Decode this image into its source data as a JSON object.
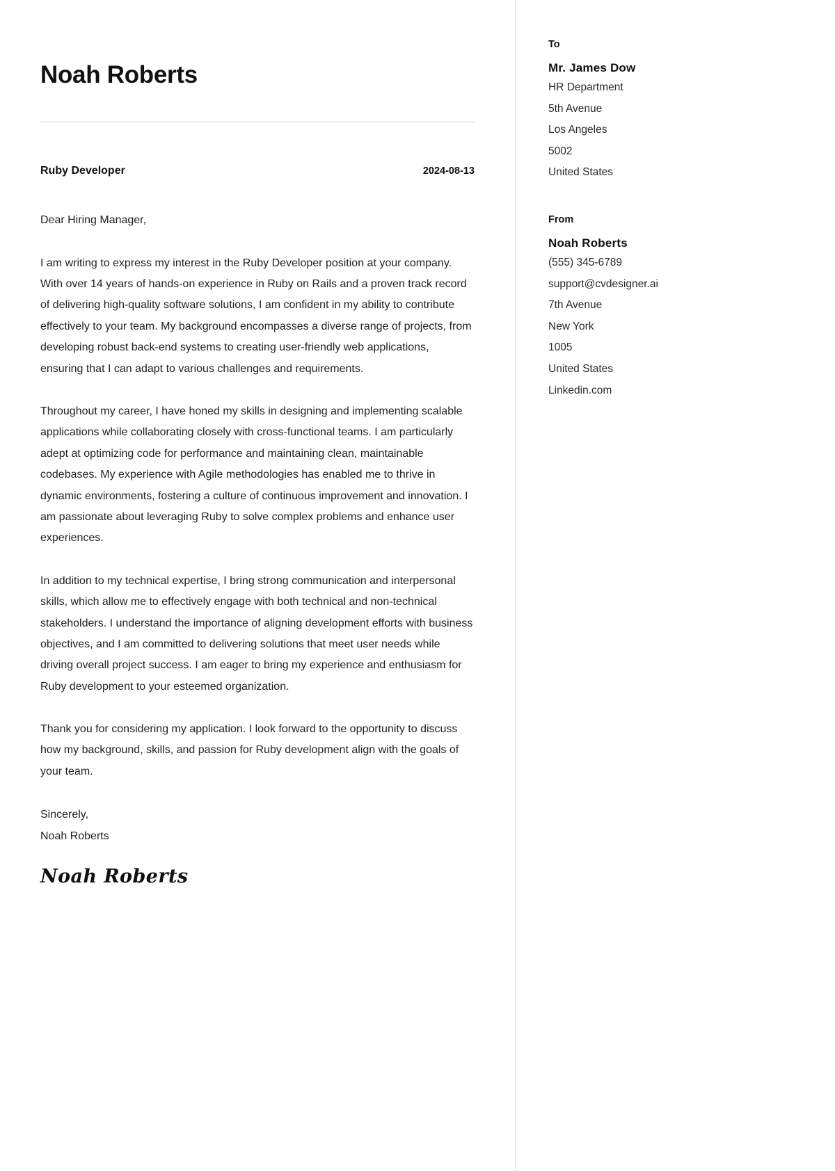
{
  "document": {
    "type": "cover-letter",
    "name_header": "Noah Roberts",
    "job_title": "Ruby Developer",
    "date": "2024-08-13",
    "salutation": "Dear Hiring Manager,",
    "paragraphs": [
      "I am writing to express my interest in the Ruby Developer position at your company. With over 14 years of hands-on experience in Ruby on Rails and a proven track record of delivering high-quality software solutions, I am confident in my ability to contribute effectively to your team. My background encompasses a diverse range of projects, from developing robust back-end systems to creating user-friendly web applications, ensuring that I can adapt to various challenges and requirements.",
      "Throughout my career, I have honed my skills in designing and implementing scalable applications while collaborating closely with cross-functional teams. I am particularly adept at optimizing code for performance and maintaining clean, maintainable codebases. My experience with Agile methodologies has enabled me to thrive in dynamic environments, fostering a culture of continuous improvement and innovation. I am passionate about leveraging Ruby to solve complex problems and enhance user experiences.",
      "In addition to my technical expertise, I bring strong communication and interpersonal skills, which allow me to effectively engage with both technical and non-technical stakeholders. I understand the importance of aligning development efforts with business objectives, and I am committed to delivering solutions that meet user needs while driving overall project success. I am eager to bring my experience and enthusiasm for Ruby development to your esteemed organization.",
      "Thank you for considering my application. I look forward to the opportunity to discuss how my background, skills, and passion for Ruby development align with the goals of your team."
    ],
    "closing_phrase": "Sincerely,",
    "closing_name": "Noah Roberts",
    "signature": "Noah Roberts"
  },
  "recipient": {
    "label": "To",
    "name": "Mr. James Dow",
    "lines": [
      "HR Department",
      "5th Avenue",
      "Los Angeles",
      "5002",
      "United States"
    ]
  },
  "sender": {
    "label": "From",
    "name": "Noah Roberts",
    "lines": [
      "(555) 345-6789",
      "support@cvdesigner.ai",
      "7th Avenue",
      "New York",
      "1005",
      "United States",
      "Linkedin.com"
    ]
  },
  "colors": {
    "page_background": "#ffffff",
    "text_primary": "#111111",
    "text_body": "#222222",
    "rule": "#d8d8d8",
    "divider": "#e2e2e2"
  }
}
